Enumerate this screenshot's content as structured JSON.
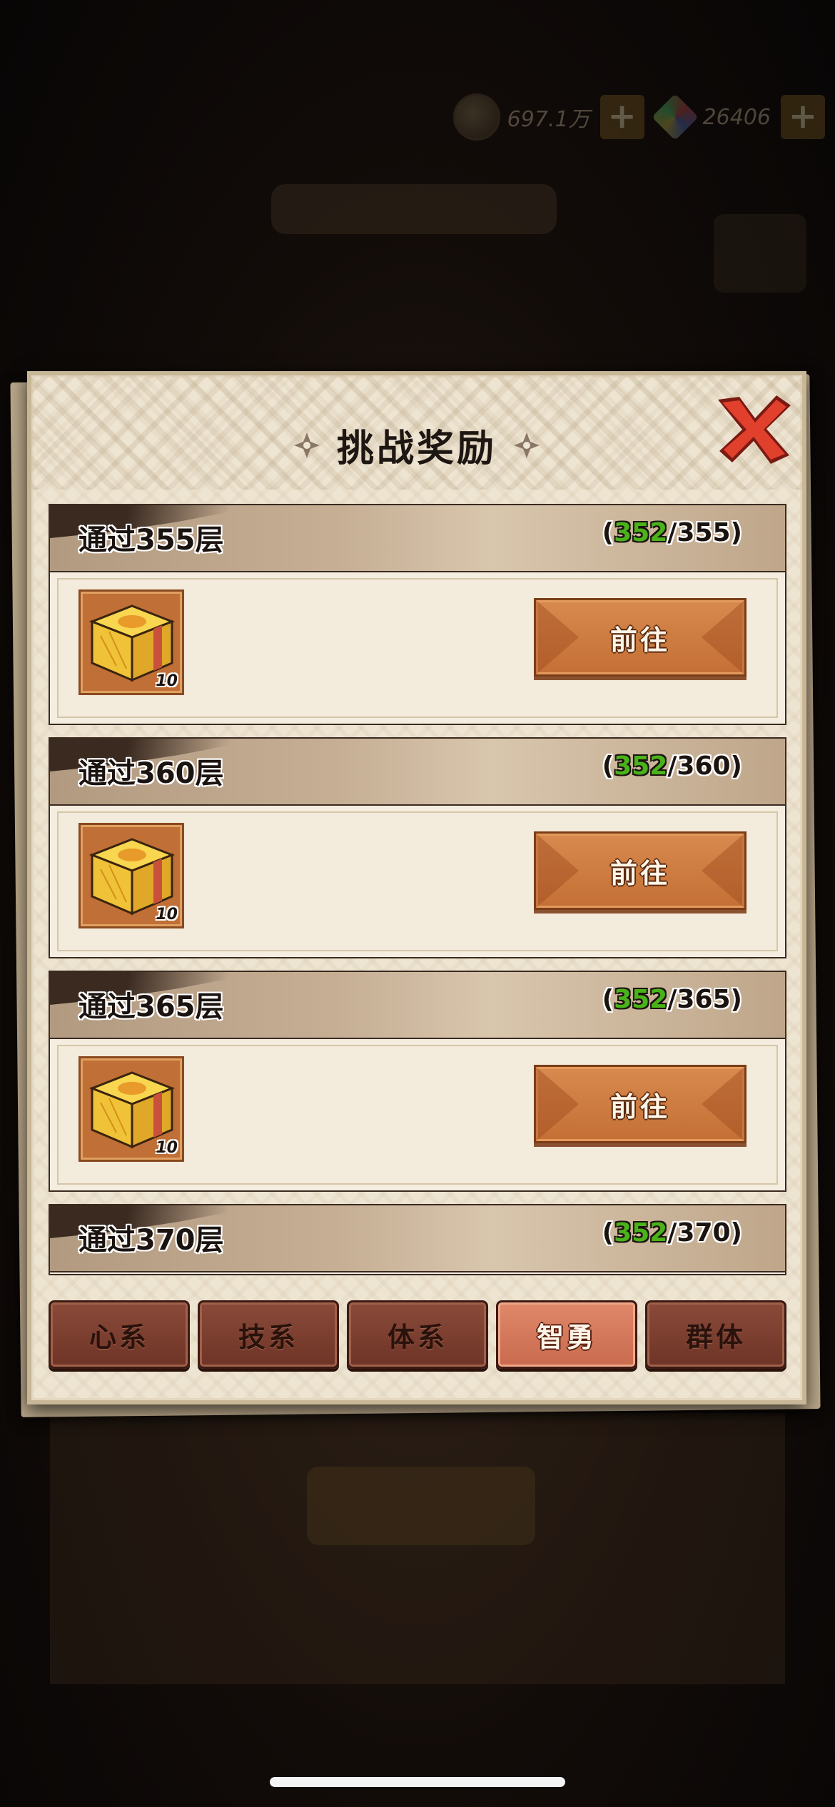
{
  "hud": {
    "coins": "697.1万",
    "gems": "26406"
  },
  "dialog": {
    "title": "挑战奖励"
  },
  "rewards": [
    {
      "title": "通过355层",
      "current": "352",
      "target": "/355",
      "item_count": "10",
      "button": "前往"
    },
    {
      "title": "通过360层",
      "current": "352",
      "target": "/360",
      "item_count": "10",
      "button": "前往"
    },
    {
      "title": "通过365层",
      "current": "352",
      "target": "/365",
      "item_count": "10",
      "button": "前往"
    },
    {
      "title": "通过370层",
      "current": "352",
      "target": "/370"
    }
  ],
  "paren_open": "(",
  "paren_close": ")",
  "tabs": [
    {
      "label": "心系",
      "active": false
    },
    {
      "label": "技系",
      "active": false
    },
    {
      "label": "体系",
      "active": false
    },
    {
      "label": "智勇",
      "active": true
    },
    {
      "label": "群体",
      "active": false
    }
  ],
  "colors": {
    "progress_current": "#4ab21a",
    "button_orange": "#c46f35",
    "tab_active": "#c86a4e",
    "tab_inactive": "#6e3426"
  }
}
